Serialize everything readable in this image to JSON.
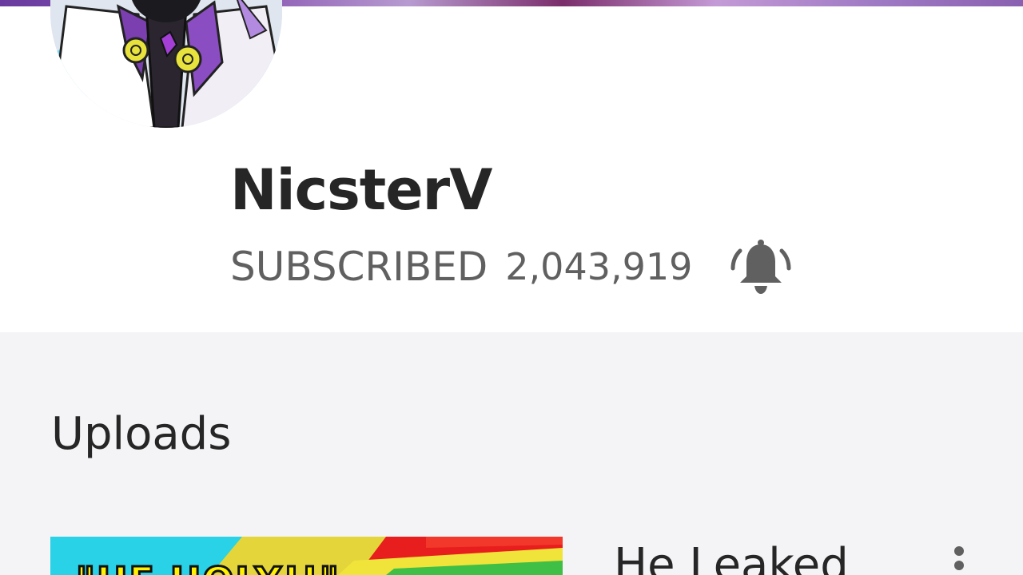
{
  "channel": {
    "name": "NicsterV",
    "subscribe_state": "SUBSCRIBED",
    "subscriber_count": "2,043,919",
    "notification_icon": "bell-ringing-icon"
  },
  "uploads": {
    "section_title": "Uploads",
    "videos": [
      {
        "title": "He Leaked",
        "thumbnail_text": "\"HE HOLY!!\""
      }
    ]
  },
  "colors": {
    "text_primary": "#262626",
    "text_secondary": "#606060",
    "header_background": "#ffffff",
    "page_background": "#f4f3f5"
  }
}
